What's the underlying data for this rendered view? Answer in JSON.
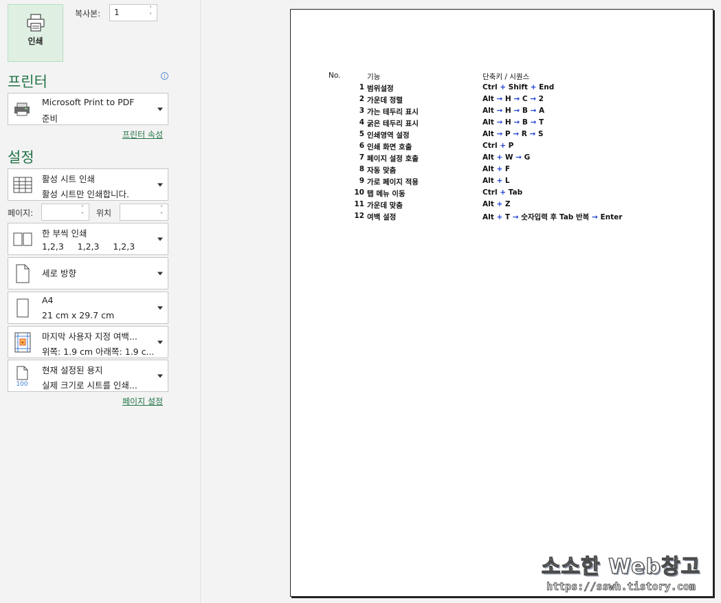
{
  "print_button": {
    "label": "인쇄",
    "icon": "printer-icon"
  },
  "copies": {
    "label": "복사본:",
    "value": "1"
  },
  "printer_section": {
    "title": "프린터",
    "name": "Microsoft Print to PDF",
    "status": "준비",
    "properties_link": "프린터 속성"
  },
  "settings_section": {
    "title": "설정",
    "what_to_print": {
      "line1": "활성 시트 인쇄",
      "line2": "활성 시트만 인쇄합니다."
    },
    "pages_label": "페이지:",
    "to_label": "위치",
    "collation": {
      "line1": "한 부씩 인쇄",
      "line2": "1,2,3     1,2,3     1,2,3"
    },
    "orientation": {
      "line1": "세로 방향"
    },
    "paper_size": {
      "line1": "A4",
      "line2": "21 cm x 29.7 cm"
    },
    "margins": {
      "line1": "마지막 사용자 지정 여백...",
      "line2": "위쪽: 1.9 cm 아래쪽: 1.9 c..."
    },
    "scaling": {
      "line1": "현재 설정된 용지",
      "line2": "실제 크기로 시트를 인쇄...",
      "icon_text": "100"
    },
    "page_setup_link": "페이지 설정"
  },
  "sheet": {
    "headers": {
      "no": "No.",
      "fn": "기능",
      "key": "단축키 / 시퀀스"
    },
    "rows": [
      {
        "no": "1",
        "fn": "범위설정",
        "key": "Ctrl + Shift + End"
      },
      {
        "no": "2",
        "fn": "가운데 정렬",
        "key": "Alt → H → C → 2"
      },
      {
        "no": "3",
        "fn": "가는 테두리 표시",
        "key": "Alt → H → B → A"
      },
      {
        "no": "4",
        "fn": "굵은 테두리 표시",
        "key": "Alt → H → B → T"
      },
      {
        "no": "5",
        "fn": "인쇄영역 설정",
        "key": "Alt → P → R → S"
      },
      {
        "no": "6",
        "fn": "인쇄 화면 호출",
        "key": "Ctrl + P"
      },
      {
        "no": "7",
        "fn": "페이지 설정 호출",
        "key": "Alt + W → G"
      },
      {
        "no": "8",
        "fn": "자동 맞춤",
        "key": "Alt + F"
      },
      {
        "no": "9",
        "fn": "가로 페이지 적용",
        "key": "Alt + L"
      },
      {
        "no": "10",
        "fn": "탭 메뉴 이동",
        "key": "Ctrl + Tab"
      },
      {
        "no": "11",
        "fn": "가운데 맞춤",
        "key": "Alt + Z"
      },
      {
        "no": "12",
        "fn": "여백 설정",
        "key": "Alt + T → 숫자입력 후 Tab 반복 → Enter"
      }
    ]
  },
  "watermark": {
    "title": "소소한 Web창고",
    "url": "https://sswh.tistory.com"
  },
  "colors": {
    "accent": "#217346",
    "print_button_bg": "#dff0e3",
    "operator_blue": "#1f3fd6"
  }
}
